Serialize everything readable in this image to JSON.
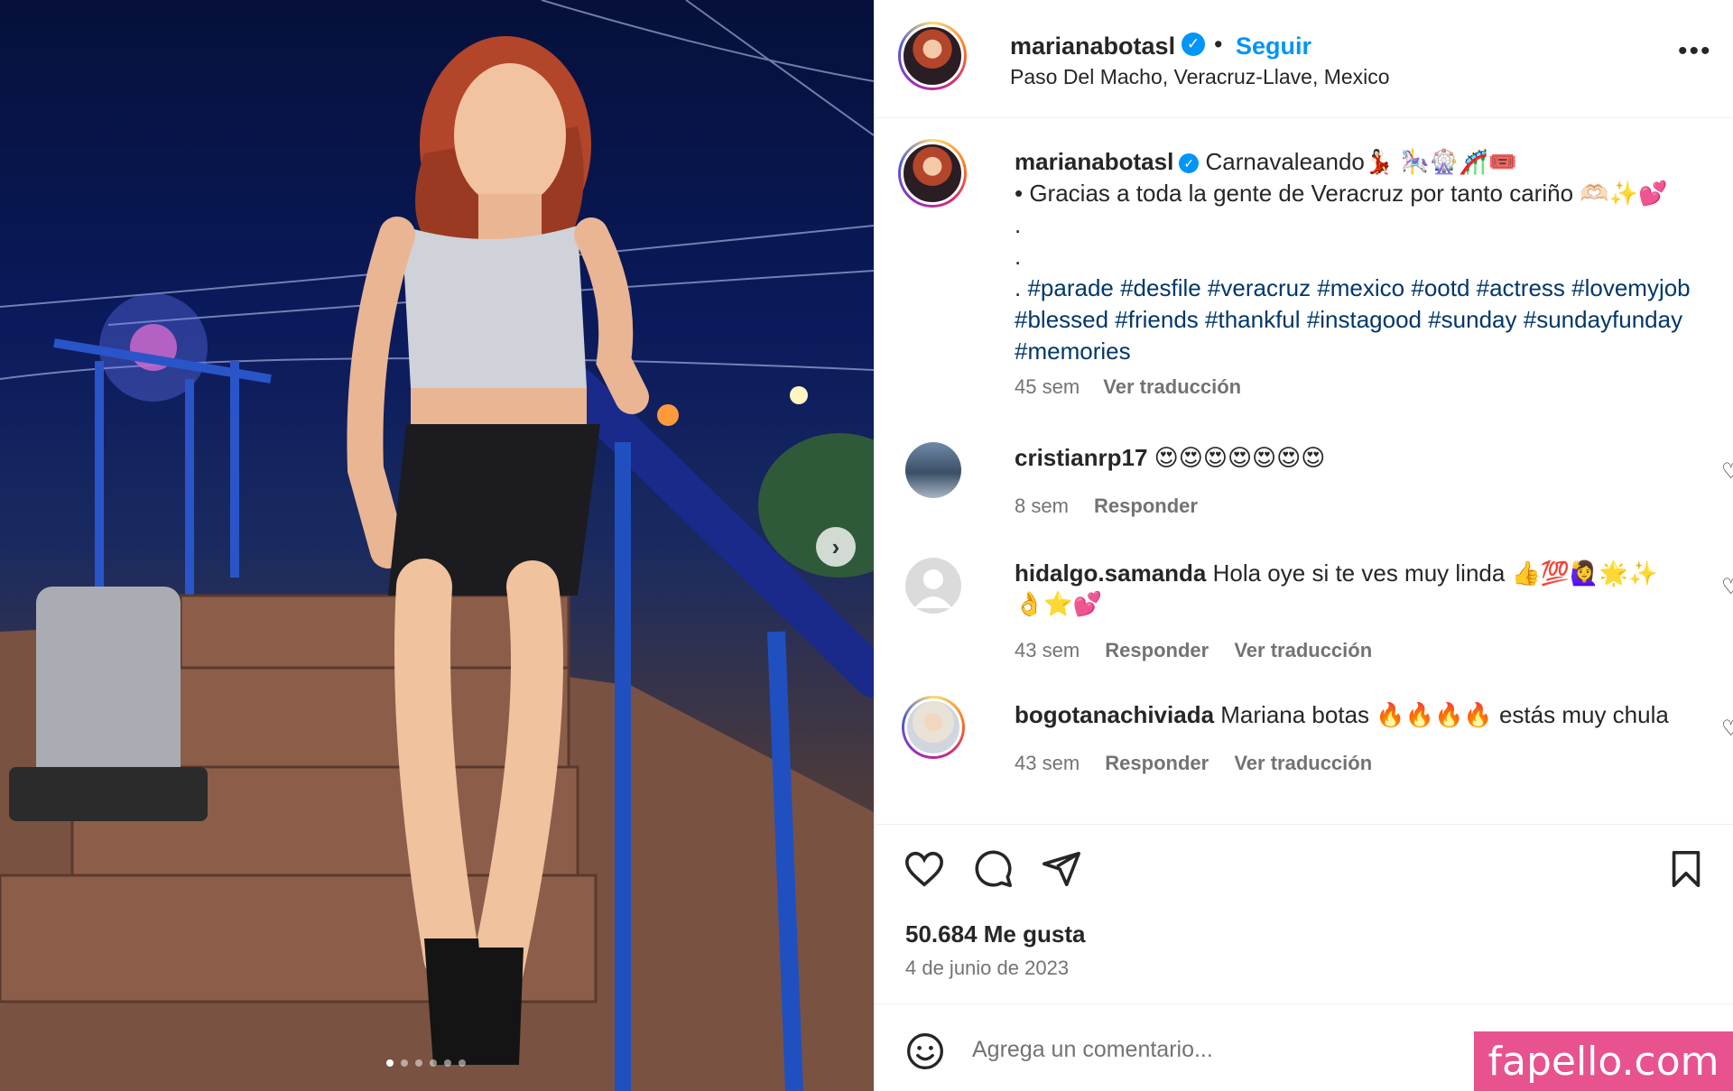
{
  "post": {
    "username": "marianabotasl",
    "follow_label": "Seguir",
    "separator": "•",
    "location": "Paso Del Macho, Veracruz-Llave, Mexico",
    "more_label": "•••",
    "carousel": {
      "total_slides": 6,
      "active_index": 0,
      "next_label": "›"
    }
  },
  "caption": {
    "username": "marianabotasl",
    "line1": " Carnavaleando💃🏻 🎠🎡🎢🎟️",
    "line2": "• Gracias a toda la gente de Veracruz por tanto cariño 🫶🏻✨💕",
    "dot1": ".",
    "dot2": ".",
    "dot3": ". ",
    "hashtags": "#parade #desfile #veracruz #mexico #ootd #actress #lovemyjob #blessed #friends #thankful #instagood #sunday #sundayfunday #memories",
    "time": "45 sem",
    "translate": "Ver traducción"
  },
  "comments": [
    {
      "username": "cristianrp17",
      "text": " 😍😍😍😍😍😍😍",
      "time": "8 sem",
      "reply": "Responder",
      "translate": ""
    },
    {
      "username": "hidalgo.samanda",
      "text": " Hola oye si te ves muy linda 👍💯🙋‍♀️🌟✨👌⭐💕",
      "time": "43 sem",
      "reply": "Responder",
      "translate": "Ver traducción"
    },
    {
      "username": "bogotanachiviada",
      "text": " Mariana botas 🔥🔥🔥🔥 estás muy chula",
      "time": "43 sem",
      "reply": "Responder",
      "translate": "Ver traducción"
    }
  ],
  "footer": {
    "likes": "50.684 Me gusta",
    "date": "4 de junio de 2023",
    "comment_placeholder": "Agrega un comentario..."
  },
  "icons": {
    "verified": "verified-badge-icon",
    "like": "heart-icon",
    "comment": "comment-bubble-icon",
    "share": "paper-plane-icon",
    "save": "bookmark-icon",
    "emoji": "smiley-icon"
  },
  "colors": {
    "link_blue": "#0095f6",
    "hashtag_blue": "#00376b",
    "muted": "#737373",
    "text": "#262626",
    "watermark_bg": "#e8528f"
  },
  "watermark": "fapello.com"
}
